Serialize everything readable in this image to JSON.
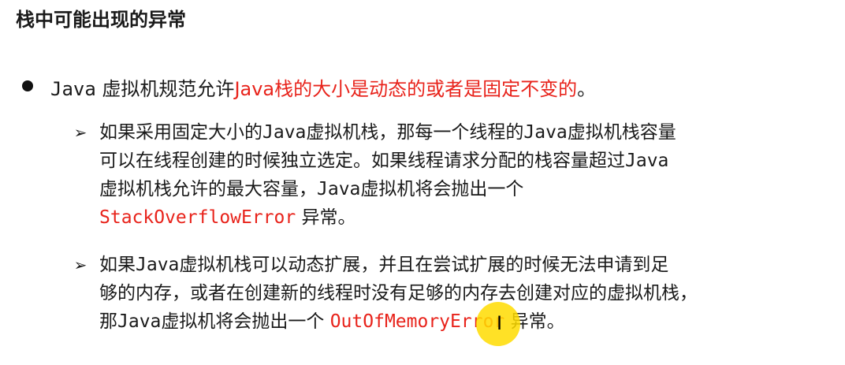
{
  "title": "栈中可能出现的异常",
  "bullet": {
    "prefix_mono": "Java",
    "prefix_text": " 虚拟机规范允许",
    "highlight": "Java栈的大小是动态的或者是固定不变的",
    "suffix": "。"
  },
  "subs": [
    {
      "line1_a": "如果采用固定大小的",
      "line1_b": "Java",
      "line1_c": "虚拟机栈，那每一个线程的",
      "line1_d": "Java",
      "line1_e": "虚拟机栈容量",
      "line2_a": "可以在线程创建的时候独立选定。如果线程请求分配的栈容量超过",
      "line2_b": "Java",
      "line3_a": "虚拟机栈允许的最大容量，",
      "line3_b": "Java",
      "line3_c": "虚拟机将会抛出一个",
      "line4_err": "StackOverflowError",
      "line4_tail": " 异常。"
    },
    {
      "line1_a": "如果",
      "line1_b": "Java",
      "line1_c": "虚拟机栈可以动态扩展，并且在尝试扩展的时候无法申请到足",
      "line2_a": "够的内存，或者在创建新的线程时没有足够的内存去创建对应的虚拟机栈，",
      "line3_a": "那",
      "line3_b": "Java",
      "line3_c": "虚拟机将会抛出一个 ",
      "line3_err": "OutOfMemoryError",
      "line3_tail": " 异常。"
    }
  ],
  "cursor": {
    "icon": "text-cursor-icon",
    "highlight_color": "#ffdc00"
  },
  "colors": {
    "accent_red": "#e8231b",
    "text": "#1a1a1a"
  }
}
